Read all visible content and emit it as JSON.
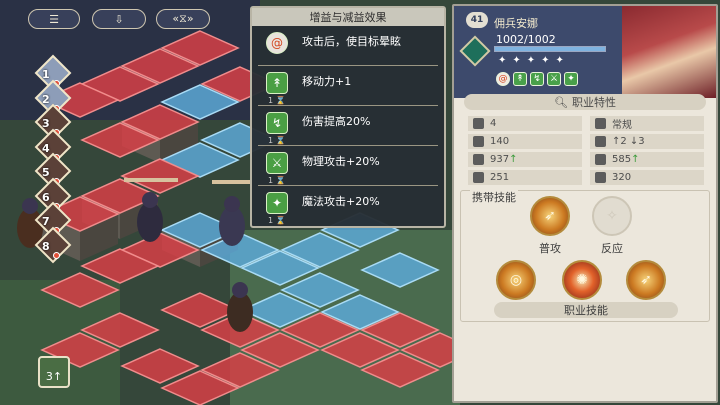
{
  "top_buttons": [
    {
      "icon": "list-icon",
      "symbol": "☰"
    },
    {
      "icon": "turn-icon",
      "symbol": "⇩"
    },
    {
      "icon": "speed-icon",
      "symbol": "«⧖»"
    }
  ],
  "turn_order": [
    {
      "num": "1",
      "side": "ally"
    },
    {
      "num": "2",
      "side": "ally"
    },
    {
      "num": "3",
      "side": "enemy"
    },
    {
      "num": "4",
      "side": "enemy"
    },
    {
      "num": "5",
      "side": "enemy"
    },
    {
      "num": "6",
      "side": "enemy"
    },
    {
      "num": "7",
      "side": "enemy"
    },
    {
      "num": "8",
      "side": "enemy"
    }
  ],
  "turn_badge": "3↑",
  "buff_panel": {
    "title": "增益与减益效果",
    "items": [
      {
        "icon": "stun-icon",
        "symbol": "@",
        "color": "red",
        "text": "攻击后，使目标晕眩",
        "duration": ""
      },
      {
        "icon": "move-up-icon",
        "symbol": "↟",
        "color": "green",
        "text": "移动力+1",
        "duration": "1 ⌛"
      },
      {
        "icon": "damage-up-icon",
        "symbol": "↯",
        "color": "green",
        "text": "伤害提高20%",
        "duration": "1 ⌛"
      },
      {
        "icon": "phys-atk-up-icon",
        "symbol": "⚔",
        "color": "green",
        "text": "物理攻击+20%",
        "duration": "1 ⌛"
      },
      {
        "icon": "magic-atk-up-icon",
        "symbol": "✦",
        "color": "green",
        "text": "魔法攻击+20%",
        "duration": "1 ⌛"
      }
    ]
  },
  "character": {
    "level": "41",
    "name": "佣兵安娜",
    "hp": "1002/1002",
    "hp_fraction": 1.0,
    "stars": "✦✦✦✦✦",
    "status_icons": [
      "@",
      "↟",
      "↯",
      "⚔",
      "✦"
    ],
    "trait_label": "职业特性",
    "stats": [
      {
        "icon": "move-icon",
        "value": "4",
        "up": ""
      },
      {
        "icon": "terrain-icon",
        "value": "常规",
        "up": ""
      },
      {
        "icon": "hp-icon",
        "value": "140",
        "up": ""
      },
      {
        "icon": "jump-icon",
        "value": "↑2 ↓3",
        "up": ""
      },
      {
        "icon": "attack-icon",
        "value": "937",
        "up": "↑"
      },
      {
        "icon": "magic-icon",
        "value": "585",
        "up": "↑"
      },
      {
        "icon": "defense-icon",
        "value": "251",
        "up": ""
      },
      {
        "icon": "resist-icon",
        "value": "320",
        "up": ""
      }
    ],
    "skills_section": "携带技能",
    "basic_skills": [
      {
        "icon": "spear-attack-icon",
        "symbol": "➶",
        "label": "普攻",
        "locked": false
      },
      {
        "icon": "counter-icon",
        "symbol": "✧",
        "label": "反应",
        "locked": true
      }
    ],
    "job_skills": [
      {
        "icon": "whirl-icon",
        "symbol": "◎",
        "locked": false
      },
      {
        "icon": "burst-icon",
        "symbol": "✺",
        "locked": false
      },
      {
        "icon": "pierce-icon",
        "symbol": "➶",
        "locked": false
      }
    ],
    "job_skills_label": "职业技能"
  }
}
